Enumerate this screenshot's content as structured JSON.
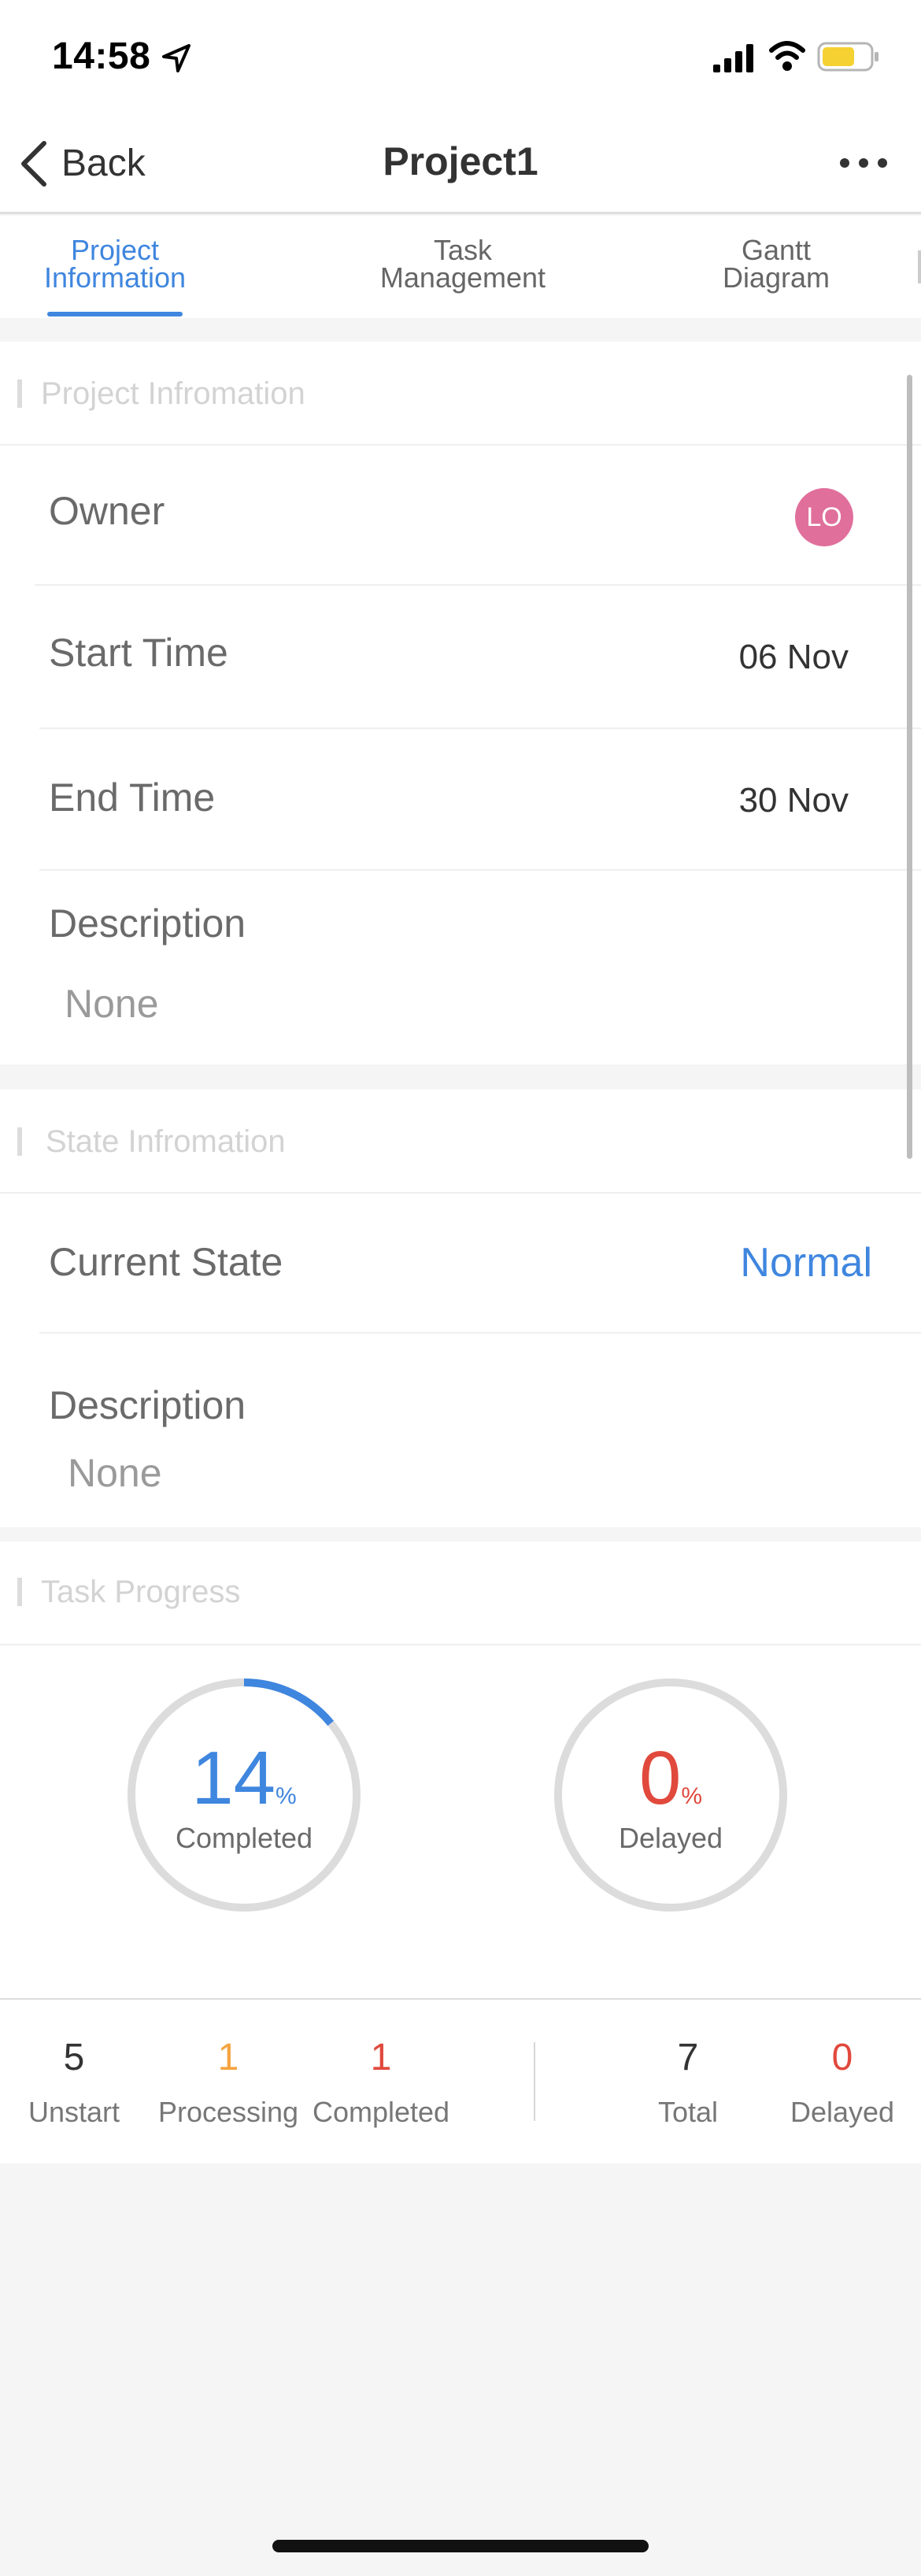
{
  "status_bar": {
    "time": "14:58"
  },
  "nav": {
    "back_label": "Back",
    "title": "Project1"
  },
  "tabs": [
    {
      "line1": "Project",
      "line2": "Information"
    },
    {
      "line1": "Task",
      "line2": "Management"
    },
    {
      "line1": "Gantt",
      "line2": "Diagram"
    }
  ],
  "project_info": {
    "section_title": "Project Infromation",
    "owner_label": "Owner",
    "owner_avatar": "LO",
    "start_label": "Start Time",
    "start_value": "06 Nov",
    "end_label": "End Time",
    "end_value": "30 Nov",
    "description_label": "Description",
    "description_value": "None"
  },
  "state_info": {
    "section_title": "State Infromation",
    "current_state_label": "Current State",
    "current_state_value": "Normal",
    "description_label": "Description",
    "description_value": "None"
  },
  "task_progress": {
    "section_title": "Task Progress",
    "completed": {
      "value": "14",
      "unit": "%",
      "label": "Completed",
      "fraction": 0.14
    },
    "delayed": {
      "value": "0",
      "unit": "%",
      "label": "Delayed",
      "fraction": 0
    }
  },
  "stats": [
    {
      "value": "5",
      "label": "Unstart"
    },
    {
      "value": "1",
      "label": "Processing"
    },
    {
      "value": "1",
      "label": "Completed"
    },
    {
      "value": "7",
      "label": "Total"
    },
    {
      "value": "0",
      "label": "Delayed"
    }
  ],
  "colors": {
    "accent": "#3f86df",
    "processing": "#f5a441",
    "danger": "#e1493d",
    "avatar": "#e06f9c",
    "ring_track": "#dcdcdc"
  }
}
